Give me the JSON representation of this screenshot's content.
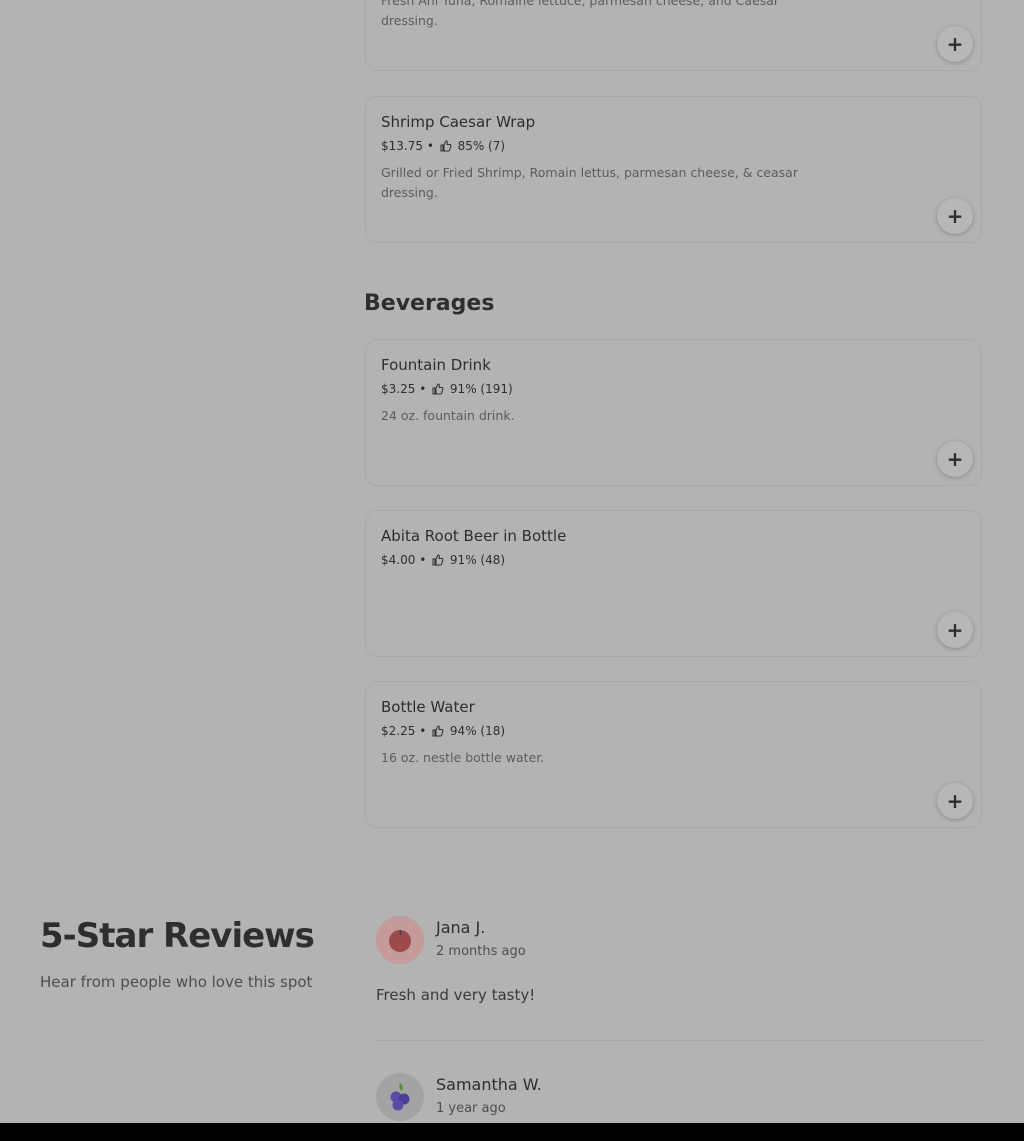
{
  "menu": {
    "items": [
      {
        "name": "",
        "meta": "",
        "rating": "",
        "desc": "Fresh Ahi Tuna, Romaine lettuce, parmesan cheese, and Caesar dressing."
      },
      {
        "name": "Shrimp Caesar Wrap",
        "price": "$13.75",
        "rating": "85% (7)",
        "desc": "Grilled or Fried Shrimp, Romain lettus, parmesan cheese, & ceasar dressing."
      },
      {
        "name": "Fountain Drink",
        "price": "$3.25",
        "rating": "91% (191)",
        "desc": "24 oz. fountain drink."
      },
      {
        "name": "Abita Root Beer in Bottle",
        "price": "$4.00",
        "rating": "91% (48)",
        "desc": ""
      },
      {
        "name": "Bottle Water",
        "price": "$2.25",
        "rating": "94% (18)",
        "desc": "16 oz. nestle bottle water."
      }
    ],
    "beverages_title": "Beverages",
    "add_label": "+",
    "separator": "•"
  },
  "reviews": {
    "title": "5-Star Reviews",
    "subtitle": "Hear from people who love this spot",
    "list": [
      {
        "name": "Jana J.",
        "time": "2 months ago",
        "text": "Fresh and very tasty!",
        "avatar_icon": "cherry-icon"
      },
      {
        "name": "Samantha W.",
        "time": "1 year ago",
        "text": "",
        "avatar_icon": "blueberry-icon"
      }
    ]
  },
  "colors": {
    "overlay_bg": "#b3b3b3",
    "text": "#2e2e2e"
  }
}
